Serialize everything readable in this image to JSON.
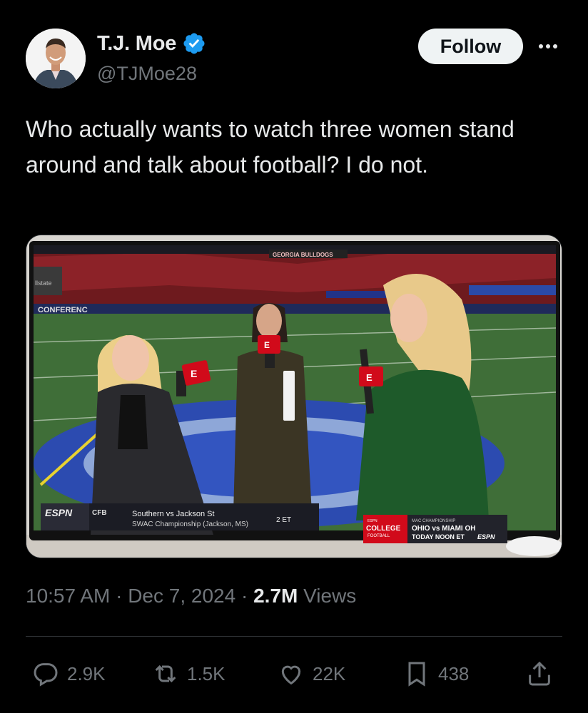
{
  "author": {
    "display_name": "T.J. Moe",
    "handle": "@TJMoe28",
    "verified": true,
    "verified_color": "#1d9bf0",
    "avatar_icon": "avatar-photo"
  },
  "header": {
    "follow_label": "Follow",
    "more_icon": "more-icon"
  },
  "tweet": {
    "text": "Who actually wants to watch three women stand around and talk about football? I do not."
  },
  "media": {
    "tv_screen": {
      "stadium_signs": [
        "GEORGIA BULLDOGS",
        "CONFERENC",
        "llstate"
      ],
      "mic_flag_letter": "E",
      "scorebug": {
        "network": "ESPN",
        "league": "CFB",
        "matchup": "Southern vs Jackson St",
        "event": "SWAC Championship (Jackson, MS)",
        "time": "2 ET",
        "promo_brand_top": "ESPN",
        "promo_brand_main": "COLLEGE",
        "promo_brand_sub": "FOOTBALL",
        "promo_title": "MAC CHAMPIONSHIP",
        "promo_matchup": "OHIO vs MIAMI OH",
        "promo_time": "TODAY NOON ET",
        "promo_network": "ESPN"
      }
    }
  },
  "meta": {
    "time": "10:57 AM",
    "date": "Dec 7, 2024",
    "separator": "·",
    "views_count": "2.7M",
    "views_label": "Views"
  },
  "actions": {
    "replies": "2.9K",
    "reposts": "1.5K",
    "likes": "22K",
    "bookmarks": "438"
  },
  "colors": {
    "background": "#000000",
    "text": "#e7e9ea",
    "secondary": "#71767b",
    "divider": "#2f3336",
    "espn_red": "#d10a1a"
  }
}
